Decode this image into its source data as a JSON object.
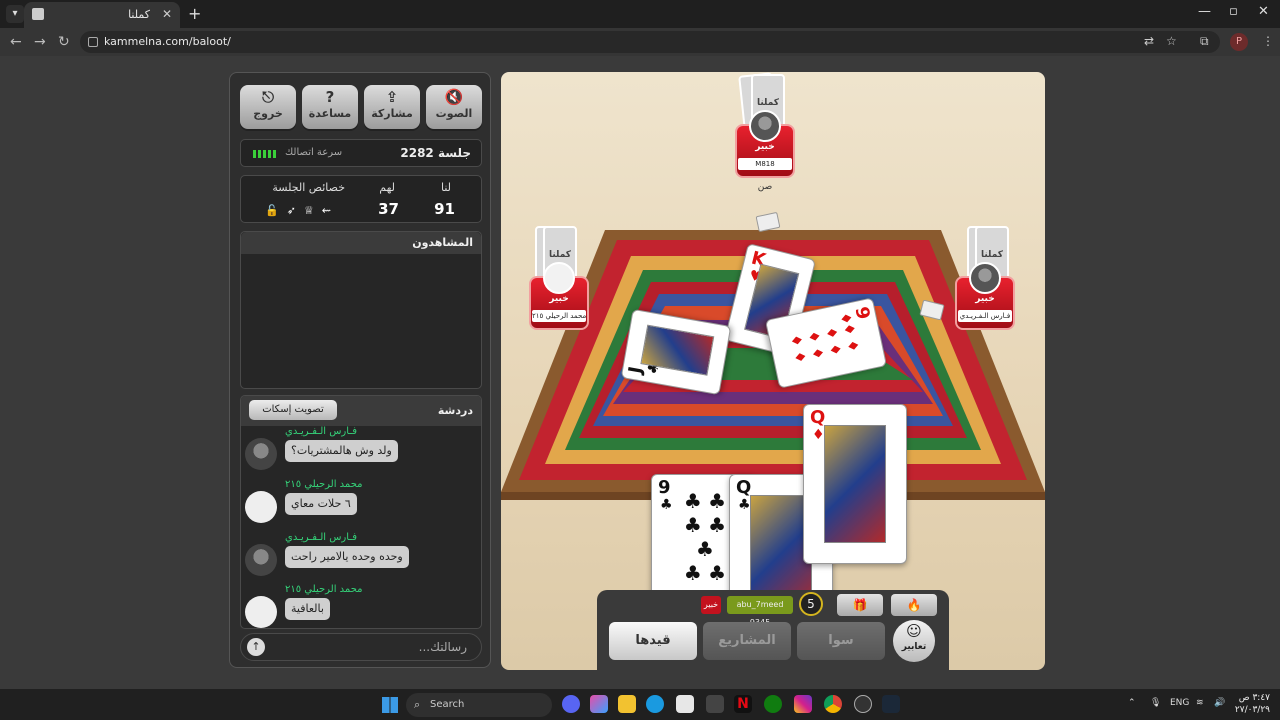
{
  "browser": {
    "tab_title": "كملنا",
    "url": "kammelna.com/baloot/",
    "profile_initial": "P"
  },
  "panel": {
    "buttons": [
      {
        "label": "الصوت",
        "icon": "🔇"
      },
      {
        "label": "مشاركة",
        "icon": "⇪"
      },
      {
        "label": "مساعدة",
        "icon": "?"
      },
      {
        "label": "خروج",
        "icon": "⎋"
      }
    ],
    "session_label": "جلسة 2282",
    "speed_label": "سرعة اتصالك",
    "scores": {
      "us_label": "لنا",
      "them_label": "لهم",
      "props_label": "خصائص الجلسة",
      "us_value": "91",
      "them_value": "37"
    },
    "watchers_title": "المشاهدون",
    "chat_title": "دردشة",
    "mute_vote_label": "تصويت إسكات",
    "messages": [
      {
        "sender": "فـارس الـفـريـدي",
        "text": "ولد وش هالمشتريات؟"
      },
      {
        "sender": "محمد الرحيلي ٢١٥",
        "text": "٦ حلات معاي"
      },
      {
        "sender": "فـارس الـفـريـدي",
        "text": "وحده وحده يالامير راحت"
      },
      {
        "sender": "محمد الرحيلي ٢١٥",
        "text": "بالعافية"
      }
    ],
    "composer_placeholder": "رسالتك..."
  },
  "game": {
    "players": {
      "top": {
        "level": "خبير",
        "name": "M818",
        "extra": "صن"
      },
      "left": {
        "level": "خبير",
        "name": "محمد الرحيلي ٢١٥"
      },
      "right": {
        "level": "خبير",
        "name": "فـارس الـفـريـدي"
      }
    },
    "card_back_text": "كملنا",
    "table_cards": [
      {
        "rank": "K",
        "suit": "♥",
        "color": "red"
      },
      {
        "rank": "J",
        "suit": "♣",
        "color": "black"
      },
      {
        "rank": "9",
        "suit": "♦",
        "color": "red"
      }
    ],
    "hand_cards": [
      {
        "rank": "9",
        "suit": "♣",
        "color": "black"
      },
      {
        "rank": "Q",
        "suit": "♣",
        "color": "black"
      },
      {
        "rank": "Q",
        "suit": "♦",
        "color": "red"
      }
    ],
    "hud": {
      "self_level": "خبير",
      "self_name": "abu_7meed 9345",
      "round_number": "5",
      "actions": [
        "قيدها",
        "المشاريع",
        "سوا"
      ],
      "emote_label": "تعابير"
    }
  },
  "taskbar": {
    "search_label": "Search",
    "lang": "ENG",
    "time": "٣:٤٧ ص",
    "date": "٢٧/٠٣/٢٩"
  }
}
